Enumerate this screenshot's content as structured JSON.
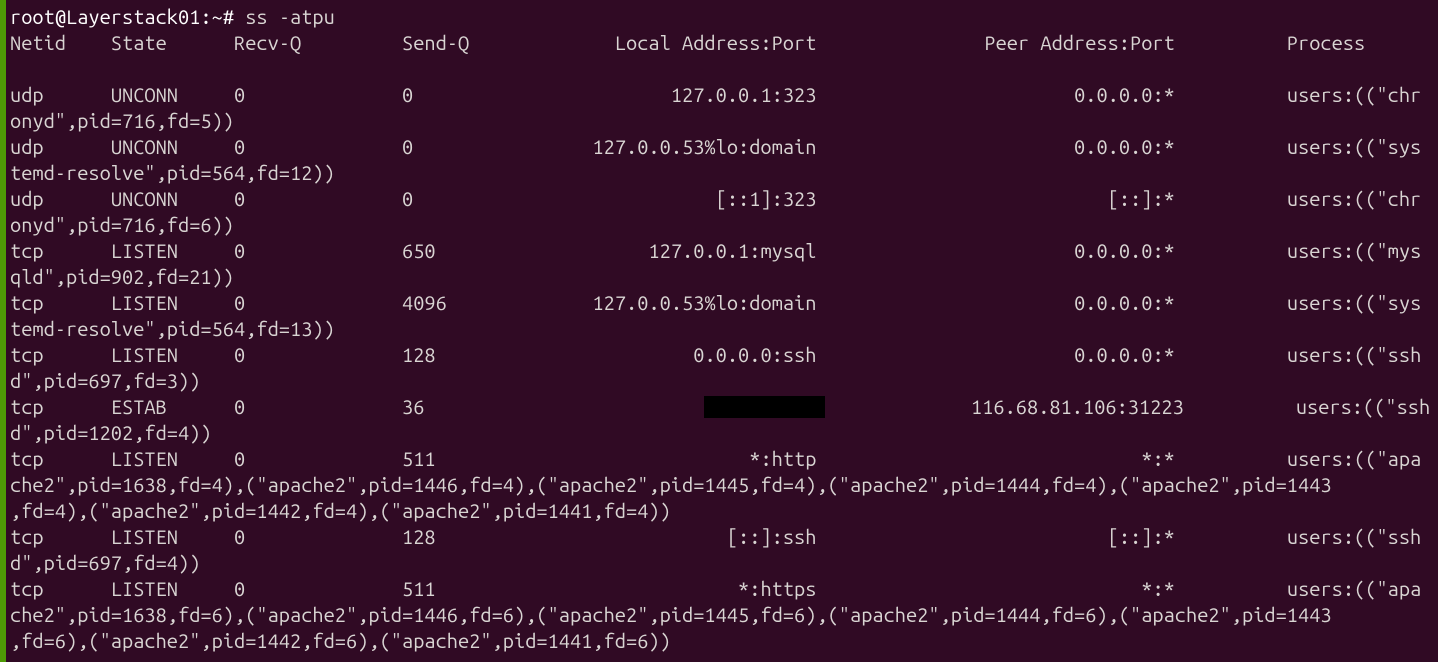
{
  "prompt": {
    "user": "root@Layerstack01",
    "path": "~",
    "symbol": "#",
    "command": "ss -atpu"
  },
  "headers": {
    "netid": "Netid",
    "state": "State",
    "recvq": "Recv-Q",
    "sendq": "Send-Q",
    "local": "Local Address:Port",
    "peer": "Peer Address:Port",
    "process": "Process"
  },
  "rows": [
    {
      "netid": "udp",
      "state": "UNCONN",
      "recvq": "0",
      "sendq": "0",
      "local": "127.0.0.1:323",
      "peer": "0.0.0.0:*",
      "process": "users:((\"chr",
      "cont": "onyd\",pid=716,fd=5))"
    },
    {
      "netid": "udp",
      "state": "UNCONN",
      "recvq": "0",
      "sendq": "0",
      "local": "127.0.0.53%lo:domain",
      "peer": "0.0.0.0:*",
      "process": "users:((\"sys",
      "cont": "temd-resolve\",pid=564,fd=12))"
    },
    {
      "netid": "udp",
      "state": "UNCONN",
      "recvq": "0",
      "sendq": "0",
      "local": "[::1]:323",
      "peer": "[::]:*",
      "process": "users:((\"chr",
      "cont": "onyd\",pid=716,fd=6))"
    },
    {
      "netid": "tcp",
      "state": "LISTEN",
      "recvq": "0",
      "sendq": "650",
      "local": "127.0.0.1:mysql",
      "peer": "0.0.0.0:*",
      "process": "users:((\"mys",
      "cont": "qld\",pid=902,fd=21))"
    },
    {
      "netid": "tcp",
      "state": "LISTEN",
      "recvq": "0",
      "sendq": "4096",
      "local": "127.0.0.53%lo:domain",
      "peer": "0.0.0.0:*",
      "process": "users:((\"sys",
      "cont": "temd-resolve\",pid=564,fd=13))"
    },
    {
      "netid": "tcp",
      "state": "LISTEN",
      "recvq": "0",
      "sendq": "128",
      "local": "0.0.0.0:ssh",
      "peer": "0.0.0.0:*",
      "process": "users:((\"ssh",
      "cont": "d\",pid=697,fd=3))"
    },
    {
      "netid": "tcp",
      "state": "ESTAB",
      "recvq": "0",
      "sendq": "36",
      "local": "",
      "peer": "116.68.81.106:31223",
      "process": "users:((\"ssh",
      "cont": "d\",pid=1202,fd=4))",
      "redacted": true
    },
    {
      "netid": "tcp",
      "state": "LISTEN",
      "recvq": "0",
      "sendq": "511",
      "local": "*:http",
      "peer": "*:*",
      "process": "users:((\"apa",
      "cont": "che2\",pid=1638,fd=4),(\"apache2\",pid=1446,fd=4),(\"apache2\",pid=1445,fd=4),(\"apache2\",pid=1444,fd=4),(\"apache2\",pid=1443\n,fd=4),(\"apache2\",pid=1442,fd=4),(\"apache2\",pid=1441,fd=4))"
    },
    {
      "netid": "tcp",
      "state": "LISTEN",
      "recvq": "0",
      "sendq": "128",
      "local": "[::]:ssh",
      "peer": "[::]:*",
      "process": "users:((\"ssh",
      "cont": "d\",pid=697,fd=4))"
    },
    {
      "netid": "tcp",
      "state": "LISTEN",
      "recvq": "0",
      "sendq": "511",
      "local": "*:https",
      "peer": "*:*",
      "process": "users:((\"apa",
      "cont": "che2\",pid=1638,fd=6),(\"apache2\",pid=1446,fd=6),(\"apache2\",pid=1445,fd=6),(\"apache2\",pid=1444,fd=6),(\"apache2\",pid=1443\n,fd=6),(\"apache2\",pid=1442,fd=6),(\"apache2\",pid=1441,fd=6))"
    }
  ],
  "layout": {
    "col_netid_start": 0,
    "col_state_start": 9,
    "col_recvq_start": 20,
    "col_sendq_start": 35,
    "col_local_end": 72,
    "col_peer_end": 104,
    "col_process_start": 114
  }
}
